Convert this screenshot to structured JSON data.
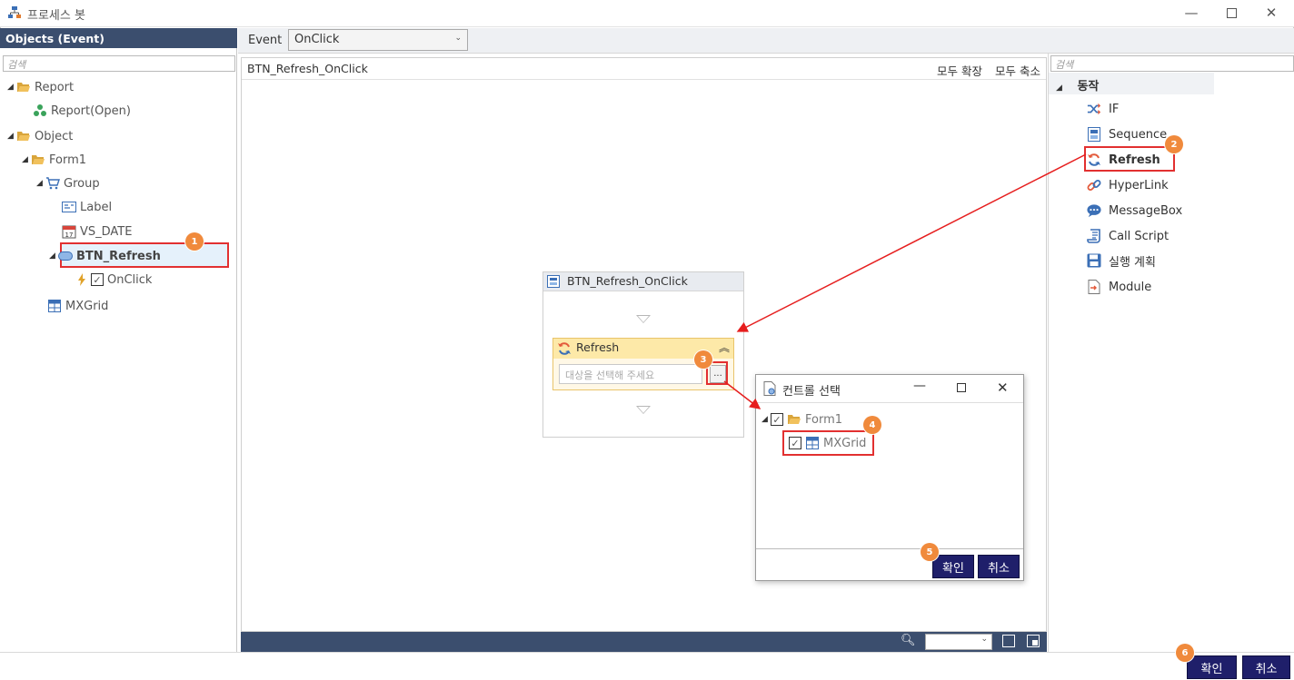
{
  "window": {
    "title": "프로세스 봇"
  },
  "left": {
    "header": "Objects (Event)",
    "search_placeholder": "검색",
    "tree": {
      "report": "Report",
      "report_open": "Report(Open)",
      "object": "Object",
      "form1": "Form1",
      "group": "Group",
      "label": "Label",
      "vs_date": "VS_DATE",
      "btn_refresh": "BTN_Refresh",
      "onclick": "OnClick",
      "mxgrid": "MXGrid"
    }
  },
  "event": {
    "label": "Event",
    "selected": "OnClick"
  },
  "canvas": {
    "title": "BTN_Refresh_OnClick",
    "expand_all": "모두 확장",
    "collapse_all": "모두 축소",
    "flow_title": "BTN_Refresh_OnClick",
    "node_title": "Refresh",
    "target_placeholder": "대상을 선택해 주세요",
    "dots": "..."
  },
  "right": {
    "search_placeholder": "검색",
    "group": "동작",
    "items": [
      "IF",
      "Sequence",
      "Refresh",
      "HyperLink",
      "MessageBox",
      "Call Script",
      "실행 계획",
      "Module"
    ]
  },
  "dialog": {
    "title": "컨트롤 선택",
    "form1": "Form1",
    "mxgrid": "MXGrid",
    "ok": "확인",
    "cancel": "취소"
  },
  "footer": {
    "ok": "확인",
    "cancel": "취소"
  },
  "badges": [
    "1",
    "2",
    "3",
    "4",
    "5",
    "6"
  ],
  "colors": {
    "header_bg": "#3b4e6e",
    "highlight": "#e23030",
    "badge": "#f08a3c",
    "button_dark": "#1f1f6a",
    "node_bg": "#fde9a8"
  }
}
